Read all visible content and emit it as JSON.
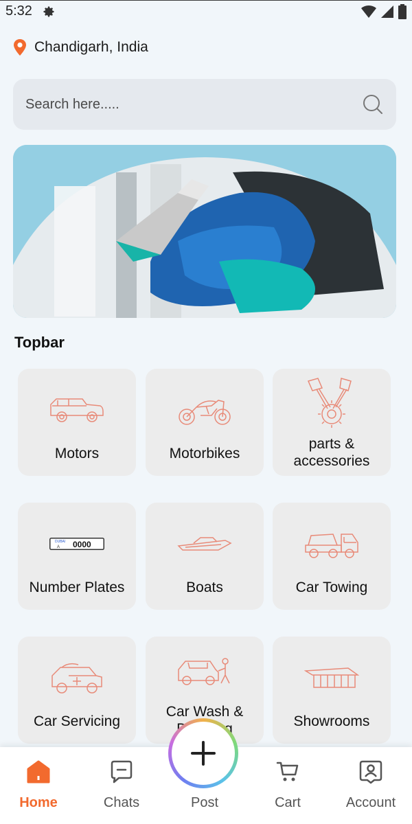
{
  "status_bar": {
    "time": "5:32"
  },
  "location": {
    "text": "Chandigarh, India"
  },
  "search": {
    "placeholder": "Search here....."
  },
  "section": {
    "title": "Topbar"
  },
  "categories": [
    {
      "label": "Motors",
      "icon": "suv-car-icon"
    },
    {
      "label": "Motorbikes",
      "icon": "motorbike-icon"
    },
    {
      "label": "parts & accessories",
      "icon": "engine-pistons-icon"
    },
    {
      "label": "Number Plates",
      "icon": "number-plate-icon",
      "plate_text": "0000",
      "plate_small": "DUBAI"
    },
    {
      "label": "Boats",
      "icon": "speedboat-icon"
    },
    {
      "label": "Car Towing",
      "icon": "tow-truck-icon"
    },
    {
      "label": "Car Servicing",
      "icon": "car-service-icon"
    },
    {
      "label": "Car Wash & Detailing",
      "icon": "car-wash-icon"
    },
    {
      "label": "Showrooms",
      "icon": "showroom-icon"
    }
  ],
  "bottom_nav": {
    "home": "Home",
    "chats": "Chats",
    "post": "Post",
    "cart": "Cart",
    "account": "Account"
  },
  "colors": {
    "accent": "#f26a2e",
    "icon_line": "#e88a78",
    "background": "#f1f6fa",
    "tile": "#ececec"
  }
}
